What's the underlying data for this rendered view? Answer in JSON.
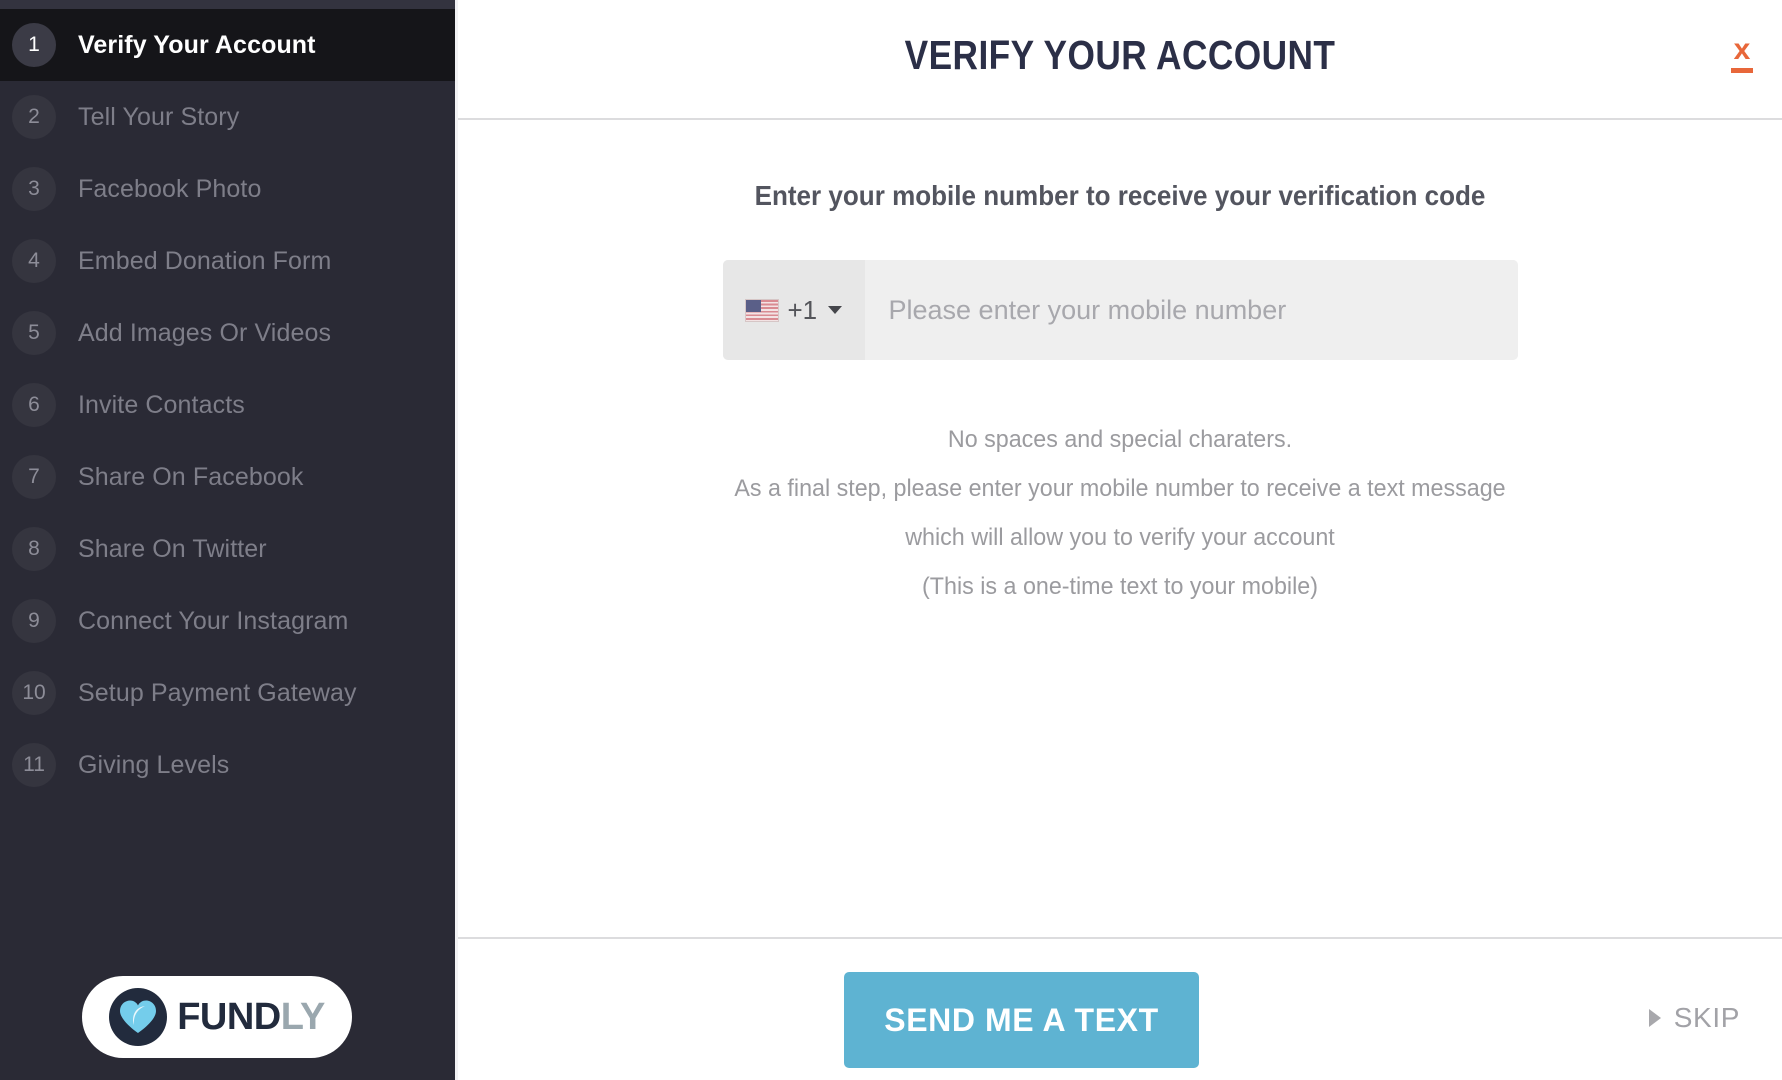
{
  "sidebar": {
    "steps": [
      {
        "number": "1",
        "label": "Verify Your Account",
        "active": true
      },
      {
        "number": "2",
        "label": "Tell Your Story",
        "active": false
      },
      {
        "number": "3",
        "label": "Facebook Photo",
        "active": false
      },
      {
        "number": "4",
        "label": "Embed Donation Form",
        "active": false
      },
      {
        "number": "5",
        "label": "Add Images Or Videos",
        "active": false
      },
      {
        "number": "6",
        "label": "Invite Contacts",
        "active": false
      },
      {
        "number": "7",
        "label": "Share On Facebook",
        "active": false
      },
      {
        "number": "8",
        "label": "Share On Twitter",
        "active": false
      },
      {
        "number": "9",
        "label": "Connect Your Instagram",
        "active": false
      },
      {
        "number": "10",
        "label": "Setup Payment Gateway",
        "active": false
      },
      {
        "number": "11",
        "label": "Giving Levels",
        "active": false
      }
    ],
    "logo": {
      "icon": "heart-icon",
      "word_primary": "FUND",
      "word_secondary": "LY"
    }
  },
  "header": {
    "title": "VERIFY YOUR ACCOUNT",
    "close_label": "x",
    "close_icon": "close-icon"
  },
  "form": {
    "heading": "Enter your mobile number to receive your verification code",
    "country": {
      "flag_icon": "us-flag-icon",
      "dial_code": "+1",
      "caret_icon": "chevron-down-icon"
    },
    "phone": {
      "value": "",
      "placeholder": "Please enter your mobile number"
    },
    "helper_lines": [
      "No spaces and special charaters.",
      "As a final step, please enter your mobile number to receive a text message",
      "which will allow you to verify your account",
      "(This is a one-time text to your mobile)"
    ]
  },
  "footer": {
    "submit_label": "SEND ME A TEXT",
    "skip_label": "SKIP",
    "skip_icon": "play-arrow-icon"
  },
  "colors": {
    "sidebar_bg": "#2a2a35",
    "sidebar_active_bg": "#151519",
    "accent_blue": "#5eb3d2",
    "accent_orange": "#e8673a",
    "title_navy": "#2b2f47"
  }
}
